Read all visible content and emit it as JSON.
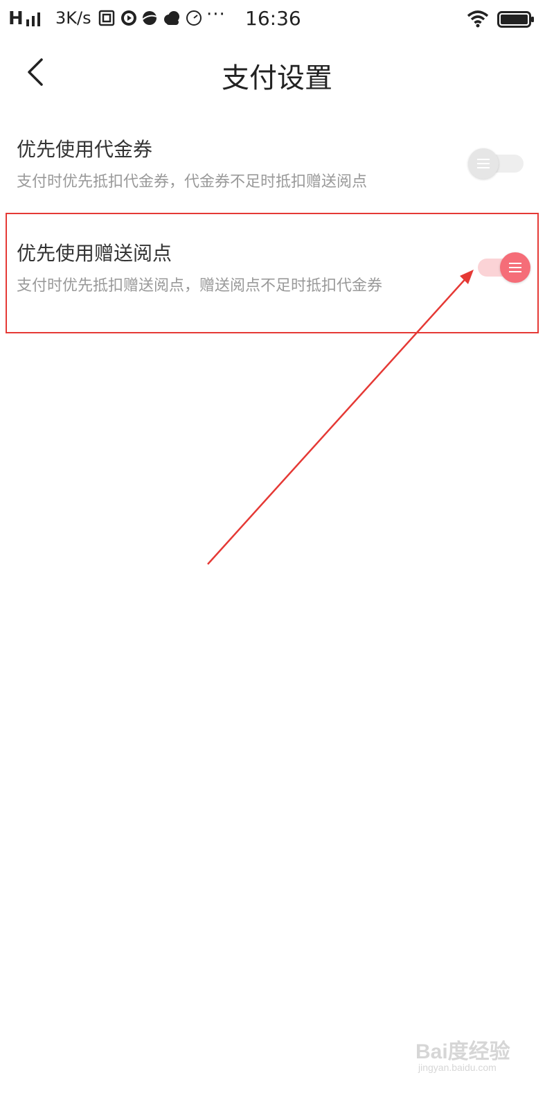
{
  "status_bar": {
    "signal": "H",
    "speed": "3K/s",
    "more": "···",
    "time": "16:36",
    "icons": [
      "signal-bars-icon",
      "app-notification-icon",
      "video-player-icon",
      "browser-icon",
      "weather-cloud-icon",
      "clock-icon",
      "wifi-icon",
      "battery-icon"
    ]
  },
  "header": {
    "title": "支付设置",
    "back_icon": "chevron-left-icon"
  },
  "settings": [
    {
      "title": "优先使用代金券",
      "description": "支付时优先抵扣代金券，代金券不足时抵扣赠送阅点",
      "enabled": false
    },
    {
      "title": "优先使用赠送阅点",
      "description": "支付时优先抵扣赠送阅点，赠送阅点不足时抵扣代金券",
      "enabled": true
    }
  ],
  "colors": {
    "toggle_on": "#f56d78",
    "toggle_on_track": "#fbd3d6",
    "toggle_off": "#e6e6e6",
    "annotation": "#e53935"
  },
  "watermark": {
    "main": "Bai度经验",
    "sub": "jingyan.baidu.com"
  }
}
